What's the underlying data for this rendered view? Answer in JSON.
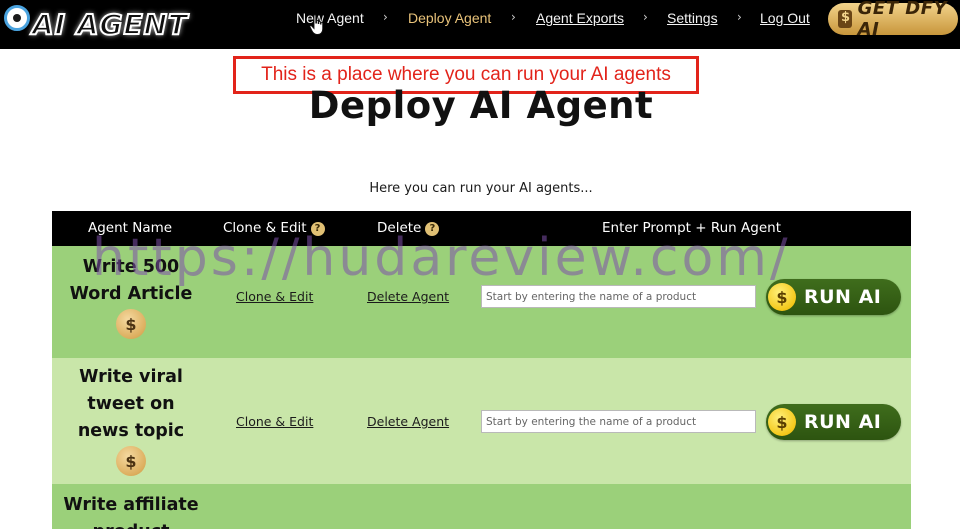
{
  "logo": {
    "text": "AI AGENT"
  },
  "nav": {
    "items": [
      {
        "label": "New Agent"
      },
      {
        "label": "Deploy Agent"
      },
      {
        "label": "Agent Exports"
      },
      {
        "label": "Settings"
      },
      {
        "label": "Log Out"
      }
    ],
    "separator": "›",
    "cta_label": "GET DFY AI"
  },
  "annotation": {
    "text": "This is a place where you can run your AI agents"
  },
  "page": {
    "title": "Deploy AI Agent",
    "subtitle": "Here you can run your AI agents..."
  },
  "table": {
    "columns": {
      "name": "Agent Name",
      "clone": "Clone & Edit",
      "delete": "Delete",
      "prompt": "Enter Prompt + Run Agent"
    },
    "help_symbol": "?",
    "coin_symbol": "$",
    "rows": [
      {
        "name_lines": [
          "Write 500",
          "Word Article"
        ],
        "clone_label": "Clone & Edit",
        "delete_label": "Delete Agent",
        "prompt_placeholder": "Start by entering the name of a product",
        "run_label": "RUN AI"
      },
      {
        "name_lines": [
          "Write viral",
          "tweet on",
          "news topic"
        ],
        "clone_label": "Clone & Edit",
        "delete_label": "Delete Agent",
        "prompt_placeholder": "Start by entering the name of a product",
        "run_label": "RUN AI"
      },
      {
        "name_lines": [
          "Write affiliate",
          "product"
        ]
      }
    ]
  },
  "watermark": {
    "text": "https://hudareview.com/"
  },
  "colors": {
    "topbar": "#000000",
    "annotation": "#e2231a",
    "row_dark": "#9bd07a",
    "row_light": "#c9e6a9",
    "run_button": "#2d5410",
    "cta_gold": "#c8963b"
  },
  "icons": {
    "logo": "robot-eye-icon",
    "cursor": "hand-pointer-icon",
    "help": "question-circle-icon",
    "coin": "dollar-coin-icon"
  }
}
